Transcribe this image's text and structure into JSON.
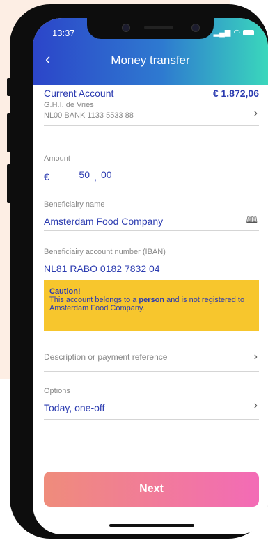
{
  "status": {
    "time": "13:37",
    "signal": "▂▄▆"
  },
  "header": {
    "title": "Money transfer",
    "back_icon": "‹"
  },
  "account": {
    "name": "Current Account",
    "balance": "€ 1.872,06",
    "holder": "G.H.I. de Vries",
    "iban": "NL00 BANK 1133 5533 88"
  },
  "amount": {
    "label": "Amount",
    "currency": "€",
    "integer": "50",
    "separator": ",",
    "decimal": "00"
  },
  "beneficiary": {
    "label": "Beneficiairy name",
    "value": "Amsterdam Food Company"
  },
  "beneficiary_iban": {
    "label": "Beneficiairy account number (IBAN)",
    "value": "NL81 RABO 0182 7832 04"
  },
  "caution": {
    "title": "Caution!",
    "text_before": "This account belongs to a ",
    "text_bold": "person",
    "text_after": " and is not registered to Amsterdam Food Company."
  },
  "description": {
    "placeholder": "Description or payment reference"
  },
  "options": {
    "label": "Options",
    "value": "Today, one-off"
  },
  "next_button": {
    "label": "Next"
  },
  "colors": {
    "header_gradient": [
      "#2c45c9",
      "#3ad7bc"
    ],
    "accent_text": "#2b3bb0",
    "caution_bg": "#f7c62d",
    "button_gradient": [
      "#ef8c7b",
      "#f36bb6"
    ]
  }
}
